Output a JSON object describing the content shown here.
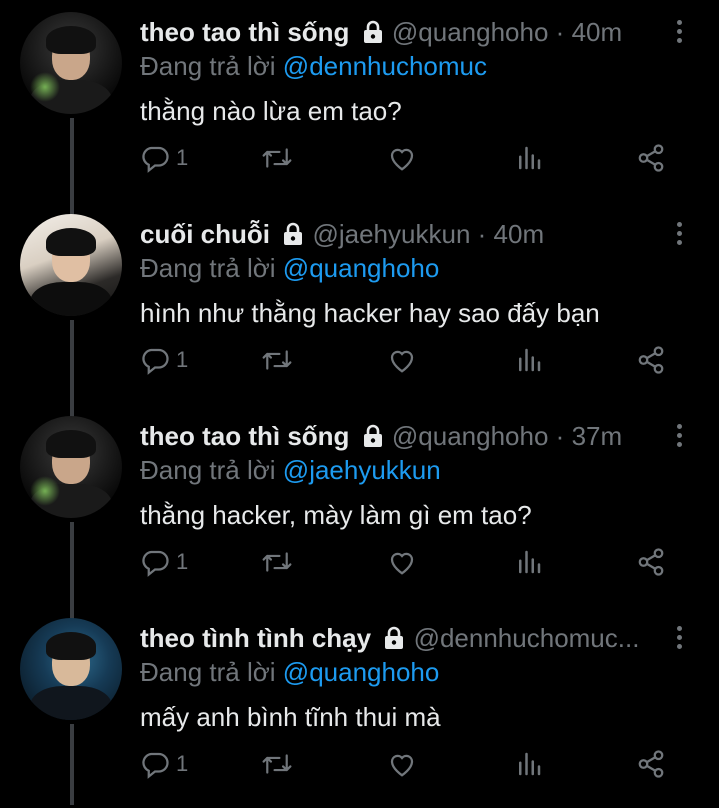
{
  "reply_prefix": "Đang trả lời",
  "tweets": [
    {
      "name": "theo tao thì sống",
      "handle": "@quanghoho",
      "dot": "·",
      "time": "40m",
      "reply_to": "@dennhuchomuc",
      "text": "thằng nào lừa em tao?",
      "reply_count": "1"
    },
    {
      "name": "cuối chuỗi",
      "handle": "@jaehyukkun",
      "dot": "·",
      "time": "40m",
      "reply_to": "@quanghoho",
      "text": "hình như thằng hacker hay sao đấy bạn",
      "reply_count": "1"
    },
    {
      "name": "theo tao thì sống",
      "handle": "@quanghoho",
      "dot": "·",
      "time": "37m",
      "reply_to": "@jaehyukkun",
      "text": "thằng hacker, mày làm gì em tao?",
      "reply_count": "1"
    },
    {
      "name": "theo tình tình chạy",
      "handle": "@dennhuchomuc...",
      "dot": "",
      "time": "",
      "reply_to": "@quanghoho",
      "text": "mấy anh bình tĩnh thui mà",
      "reply_count": "1"
    }
  ],
  "colors": {
    "background": "#000000",
    "text": "#e7e9ea",
    "muted": "#71767b",
    "mention": "#1d9bf0",
    "thread_line": "#3a3d41"
  },
  "icons": [
    "lock-icon",
    "more-icon",
    "reply-icon",
    "retweet-icon",
    "like-icon",
    "analytics-icon",
    "share-icon"
  ]
}
